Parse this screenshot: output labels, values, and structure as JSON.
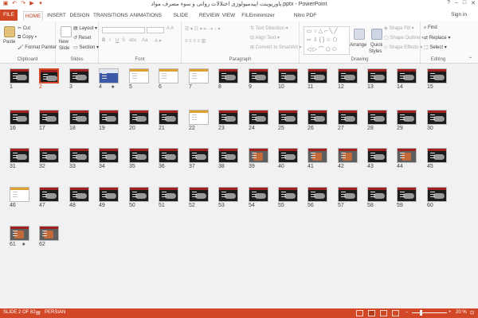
{
  "window": {
    "title": "پاورپوینت اپیدمیولوژی اختلالات روانی و سوء مصرف مواد.pptx - PowerPoint",
    "controls": [
      "?",
      "–",
      "□",
      "✕"
    ]
  },
  "qat": [
    "save-icon",
    "undo-icon",
    "redo-icon",
    "start-icon",
    "customize-icon"
  ],
  "tabs": [
    "FILE",
    "HOME",
    "INSERT",
    "DESIGN",
    "TRANSITIONS",
    "ANIMATIONS",
    "SLIDE SHOW",
    "REVIEW",
    "VIEW",
    "FILEminimizer",
    "Nitro PDF Professional"
  ],
  "active_tab": "HOME",
  "sign_in": "Sign in",
  "ribbon": {
    "clipboard": {
      "paste": "Paste",
      "cut": "Cut",
      "copy": "Copy",
      "format_painter": "Format Painter",
      "label": "Clipboard"
    },
    "slides": {
      "new_slide": "New",
      "new_slide2": "Slide",
      "layout": "Layout",
      "reset": "Reset",
      "section": "Section",
      "label": "Slides"
    },
    "font": {
      "label": "Font",
      "bold": "B",
      "italic": "I",
      "underline": "U",
      "strike": "S",
      "shadow": "abc",
      "case": "Aa"
    },
    "paragraph": {
      "text_direction": "Text Direction",
      "align_text": "Align Text",
      "smartart": "Convert to SmartArt",
      "label": "Paragraph"
    },
    "drawing": {
      "arrange": "Arrange",
      "quick_styles": "Quick",
      "quick_styles2": "Styles",
      "shape_fill": "Shape Fill",
      "shape_outline": "Shape Outline",
      "shape_effects": "Shape Effects",
      "label": "Drawing"
    },
    "editing": {
      "find": "Find",
      "replace": "Replace",
      "select": "Select",
      "label": "Editing"
    }
  },
  "slides": [
    {
      "n": "1",
      "style": "dark"
    },
    {
      "n": "2",
      "style": "dark",
      "selected": true
    },
    {
      "n": "3",
      "style": "dark"
    },
    {
      "n": "4",
      "style": "blue",
      "star": true
    },
    {
      "n": "5",
      "style": "white"
    },
    {
      "n": "6",
      "style": "white"
    },
    {
      "n": "7",
      "style": "white"
    },
    {
      "n": "8",
      "style": "dark"
    },
    {
      "n": "9",
      "style": "dark"
    },
    {
      "n": "10",
      "style": "dark"
    },
    {
      "n": "11",
      "style": "dark"
    },
    {
      "n": "12",
      "style": "dark"
    },
    {
      "n": "13",
      "style": "dark"
    },
    {
      "n": "14",
      "style": "dark"
    },
    {
      "n": "15",
      "style": "dark"
    },
    {
      "n": "16",
      "style": "dark"
    },
    {
      "n": "17",
      "style": "dark"
    },
    {
      "n": "18",
      "style": "dark"
    },
    {
      "n": "19",
      "style": "dark"
    },
    {
      "n": "20",
      "style": "dark"
    },
    {
      "n": "21",
      "style": "dark"
    },
    {
      "n": "22",
      "style": "white"
    },
    {
      "n": "23",
      "style": "dark"
    },
    {
      "n": "24",
      "style": "dark"
    },
    {
      "n": "25",
      "style": "dark"
    },
    {
      "n": "26",
      "style": "dark"
    },
    {
      "n": "27",
      "style": "dark"
    },
    {
      "n": "28",
      "style": "dark"
    },
    {
      "n": "29",
      "style": "dark"
    },
    {
      "n": "30",
      "style": "dark"
    },
    {
      "n": "31",
      "style": "dark"
    },
    {
      "n": "32",
      "style": "dark"
    },
    {
      "n": "33",
      "style": "dark"
    },
    {
      "n": "34",
      "style": "dark"
    },
    {
      "n": "35",
      "style": "dark"
    },
    {
      "n": "36",
      "style": "dark"
    },
    {
      "n": "37",
      "style": "dark"
    },
    {
      "n": "38",
      "style": "dark"
    },
    {
      "n": "39",
      "style": "photo"
    },
    {
      "n": "40",
      "style": "dark"
    },
    {
      "n": "41",
      "style": "photo"
    },
    {
      "n": "42",
      "style": "photo"
    },
    {
      "n": "43",
      "style": "dark"
    },
    {
      "n": "44",
      "style": "photo"
    },
    {
      "n": "45",
      "style": "dark"
    },
    {
      "n": "46",
      "style": "white"
    },
    {
      "n": "47",
      "style": "dark"
    },
    {
      "n": "48",
      "style": "dark"
    },
    {
      "n": "49",
      "style": "dark"
    },
    {
      "n": "50",
      "style": "dark"
    },
    {
      "n": "51",
      "style": "dark"
    },
    {
      "n": "52",
      "style": "dark"
    },
    {
      "n": "53",
      "style": "dark"
    },
    {
      "n": "54",
      "style": "dark"
    },
    {
      "n": "55",
      "style": "dark"
    },
    {
      "n": "56",
      "style": "dark"
    },
    {
      "n": "57",
      "style": "dark"
    },
    {
      "n": "58",
      "style": "dark"
    },
    {
      "n": "59",
      "style": "dark"
    },
    {
      "n": "60",
      "style": "dark"
    },
    {
      "n": "61",
      "style": "photo",
      "star": true
    },
    {
      "n": "62",
      "style": "photo"
    }
  ],
  "status": {
    "slide_info": "SLIDE 2 OF 62",
    "language": "PERSIAN",
    "zoom": "20 %"
  },
  "colors": {
    "accent": "#d24726"
  }
}
